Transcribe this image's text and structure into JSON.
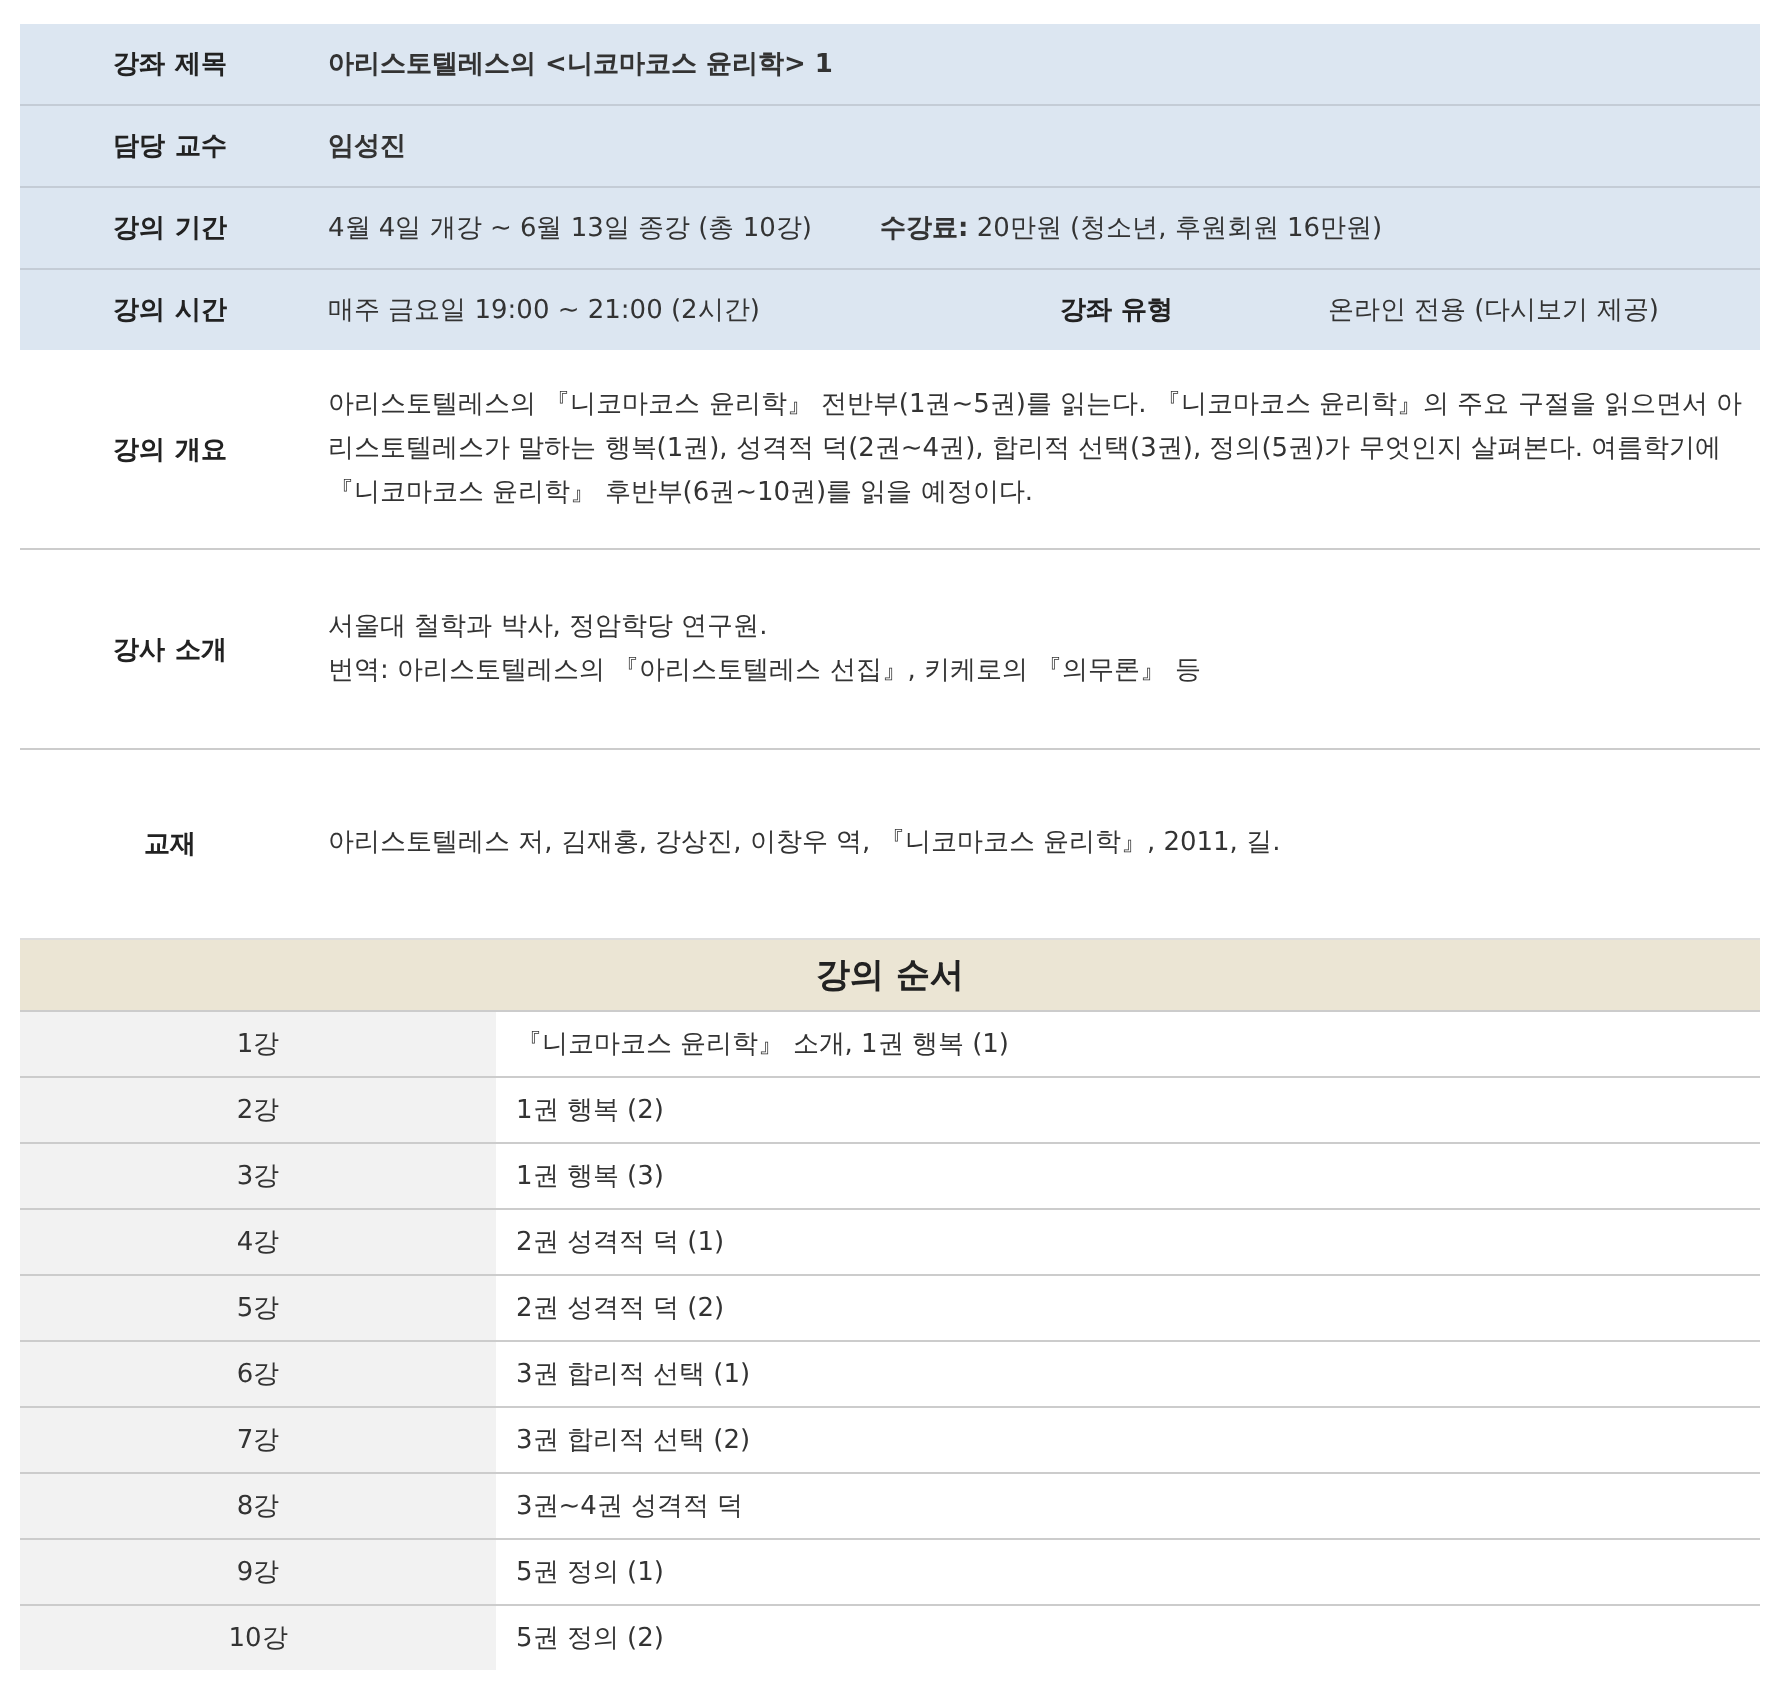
{
  "info_rows": [
    {
      "label": "강좌 제목",
      "value": "아리스토텔레스의 <니코마코스 윤리학> 1",
      "bold": true
    },
    {
      "label": "담당 교수",
      "value": "임성진",
      "bold": true
    },
    {
      "label": "강의 기간",
      "value": "4월 4일 개강 ~ 6월 13일 종강 (총 10강)",
      "extra": "**수강료:** 20만원 (청소년, 후원회원 16만원)",
      "bold": false
    },
    {
      "label": "강의 시간",
      "value": "매주 금요일 19:00 ~ 21:00 (2시간)",
      "extra_label": "강좌 유형",
      "extra_value": "온라인 전용 (다시보기 제공)",
      "bold": false
    }
  ],
  "detail_rows": [
    {
      "label": "강의 개요",
      "lines": [
        "아리스토텔레스의 『니코마코스 윤리학』 전반부(1권~5권)를 읽는다. 『니코마코스 윤리학』의 주요 구절을 읽으면서 아리스토텔레스가 말하는 행복(1권), 성격적 덕(2권~4권), 합리적 선택(3권), 정의(5권)가 무엇인지 살펴본다. 여름학기에 『니코마코스 윤리학』 후반부(6권~10권)를 읽을 예정이다."
      ]
    },
    {
      "label": "강사 소개",
      "lines": [
        "서울대 철학과 박사, 정암학당 연구원.",
        "번역: 아리스토텔레스의 『아리스토텔레스 선집』, 키케로의 『의무론』 등"
      ]
    },
    {
      "label": "교재",
      "lines": [
        "아리스토텔레스 저, 김재홍, 강상진, 이창우 역, 『니코마코스 윤리학』, 2011, 길."
      ]
    }
  ],
  "schedule": {
    "title": "강의 순서",
    "rows": [
      {
        "session": "1강",
        "topic": "『니코마코스 윤리학』 소개, 1권 행복 (1)"
      },
      {
        "session": "2강",
        "topic": "1권 행복 (2)"
      },
      {
        "session": "3강",
        "topic": "1권 행복 (3)"
      },
      {
        "session": "4강",
        "topic": "2권 성격적 덕 (1)"
      },
      {
        "session": "5강",
        "topic": "2권 성격적 덕 (2)"
      },
      {
        "session": "6강",
        "topic": "3권 합리적 선택 (1)"
      },
      {
        "session": "7강",
        "topic": "3권 합리적 선택 (2)"
      },
      {
        "session": "8강",
        "topic": "3권~4권 성격적 덕"
      },
      {
        "session": "9강",
        "topic": "5권 정의 (1)"
      },
      {
        "session": "10강",
        "topic": "5권 정의 (2)"
      }
    ]
  }
}
